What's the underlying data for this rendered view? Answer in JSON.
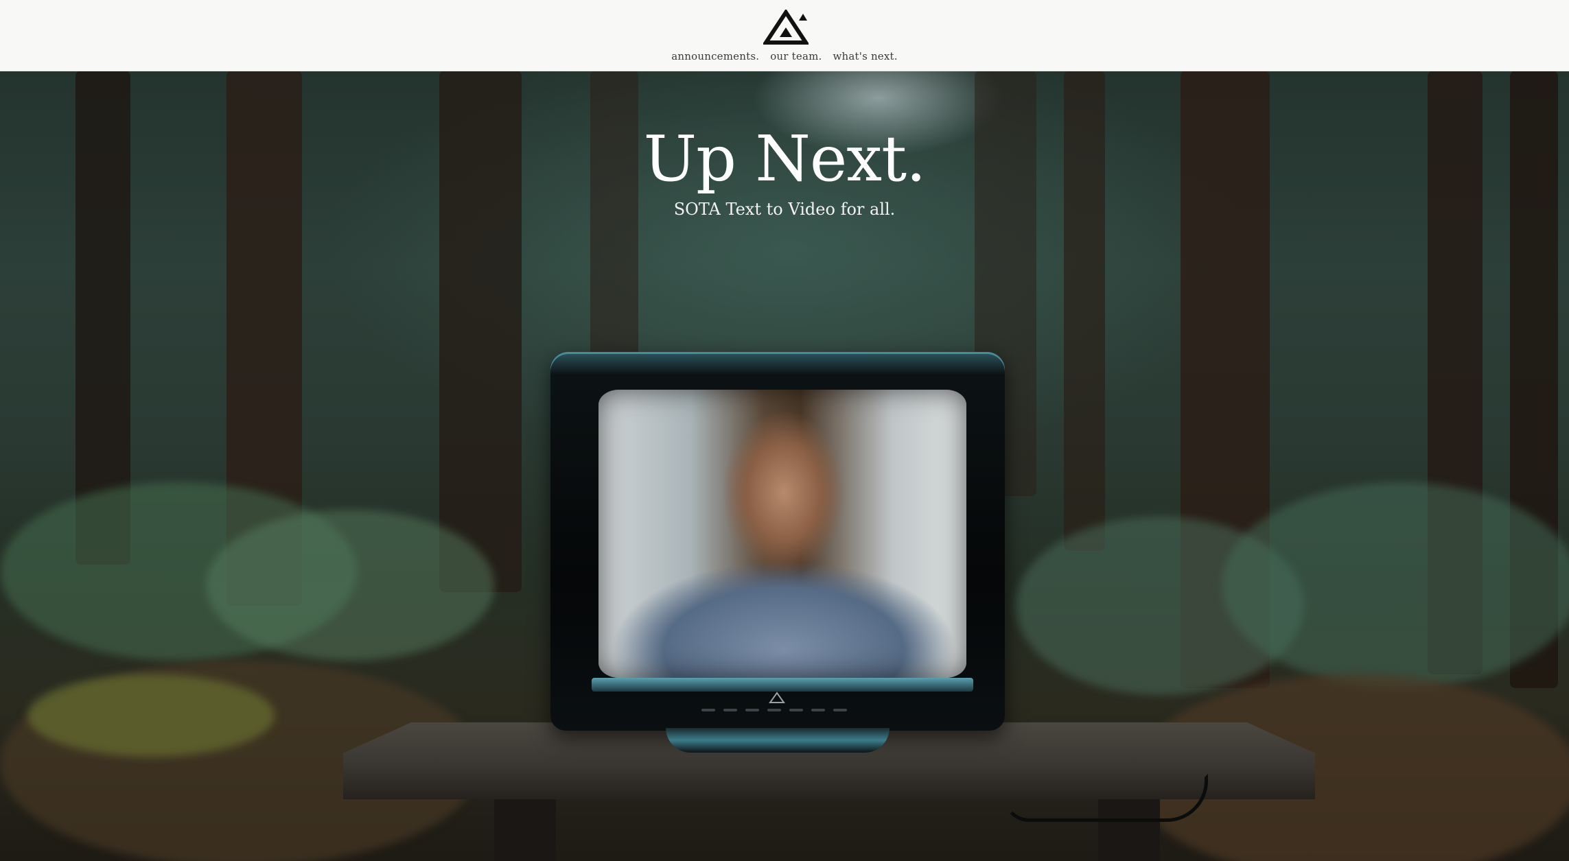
{
  "header": {
    "logo_icon": "triangle-logo-icon",
    "nav": [
      {
        "label": "announcements."
      },
      {
        "label": "our team."
      },
      {
        "label": "what's next."
      }
    ]
  },
  "hero": {
    "title": "Up Next.",
    "subtitle": "SOTA Text to Video for all.",
    "background_icon": "forest-tv-photo"
  },
  "colors": {
    "header_bg": "#f8f8f7",
    "nav_text": "#3a3a3a",
    "hero_text": "#ffffff"
  }
}
